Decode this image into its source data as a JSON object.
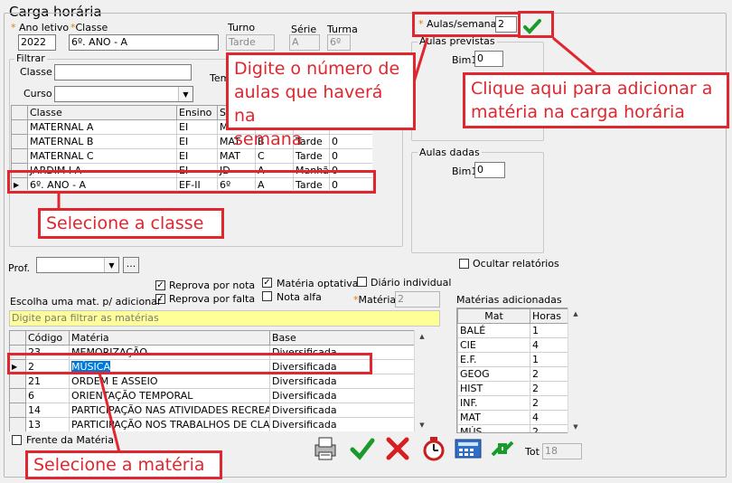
{
  "window_title": "Carga horária",
  "top": {
    "ano_letivo_label": "Ano letivo",
    "ano_letivo_value": "2022",
    "classe_label": "Classe",
    "classe_value": "6º. ANO  - A",
    "turno_label": "Turno",
    "turno_value": "Tarde",
    "serie_label": "Série",
    "serie_value": "A",
    "turma_label": "Turma",
    "turma_value": "6º",
    "aulas_semana_label": "Aulas/semana",
    "aulas_semana_value": "2"
  },
  "filtrar": {
    "title": "Filtrar",
    "classe_label": "Classe",
    "curso_label": "Curso",
    "term_label": "Tem"
  },
  "classes_table": {
    "columns": [
      "Classe",
      "Ensino",
      "S"
    ],
    "rows": [
      [
        "MATERNAL A",
        "EI",
        "M",
        "",
        "",
        ""
      ],
      [
        "MATERNAL B",
        "EI",
        "MAT",
        "B",
        "Tarde",
        "0"
      ],
      [
        "MATERNAL C",
        "EI",
        "MAT",
        "C",
        "Tarde",
        "0"
      ],
      [
        "JARDIM I A",
        "EI",
        "JD",
        "A",
        "Manhã",
        "0"
      ],
      [
        "6º. ANO  - A",
        "EF-II",
        "6º",
        "A",
        "Tarde",
        "0"
      ]
    ]
  },
  "aulas_previstas": {
    "title": "Aulas previstas",
    "bim_label": "Bim1",
    "bim_value": "0"
  },
  "aulas_dadas": {
    "title": "Aulas dadas",
    "bim_label": "Bim1",
    "bim_value": "0"
  },
  "options": {
    "ocultar_relatorios": "Ocultar relatórios",
    "prof_label": "Prof.",
    "prof_button": "...",
    "reprova_nota": "Reprova por nota",
    "reprova_falta": "Reprova por falta",
    "materia_optativa": "Matéria optativa",
    "nota_alfa": "Nota alfa",
    "diario_individual": "Diário individual",
    "materia_label": "Matéria",
    "materia_value": "2",
    "escolha_label": "Escolha uma mat. p/ adicionar",
    "filter_placeholder": "Digite para filtrar as matérias",
    "frente_materia": "Frente da Matéria",
    "tot_label": "Tot",
    "tot_value": "18"
  },
  "materias_table": {
    "columns": [
      "Código",
      "Matéria",
      "Base"
    ],
    "rows": [
      [
        "23",
        "MEMORIZAÇÃO",
        "Diversificada"
      ],
      [
        "2",
        "MÚSICA",
        "Diversificada"
      ],
      [
        "21",
        "ORDEM E ASSEIO",
        "Diversificada"
      ],
      [
        "6",
        "ORIENTAÇÃO TEMPORAL",
        "Diversificada"
      ],
      [
        "14",
        "PARTICIPAÇÃO NAS ATIVIDADES RECREA",
        "Diversificada"
      ],
      [
        "13",
        "PARTICIPAÇÃO NOS TRABALHOS DE CLAS",
        "Diversificada"
      ]
    ]
  },
  "adicionadas": {
    "title": "Matérias adicionadas",
    "columns": [
      "Mat",
      "Horas"
    ],
    "rows": [
      [
        "BALÉ",
        "1"
      ],
      [
        "CIE",
        "4"
      ],
      [
        "E.F.",
        "1"
      ],
      [
        "GEOG",
        "2"
      ],
      [
        "HIST",
        "2"
      ],
      [
        "INF.",
        "2"
      ],
      [
        "MAT",
        "4"
      ],
      [
        "MÚS",
        "2"
      ]
    ]
  },
  "annotations": {
    "digite_line1": "Digite o número de",
    "digite_line2": "aulas que haverá na",
    "digite_line3": "semana",
    "clique_line1": "Clique aqui para adicionar a",
    "clique_line2": "matéria na carga horária",
    "selecione_classe": "Selecione a classe",
    "selecione_materia": "Selecione a matéria"
  },
  "colors": {
    "annotation_red": "#e0262f",
    "filter_yellow": "#ffff9a",
    "selection_blue": "#0078d7"
  }
}
